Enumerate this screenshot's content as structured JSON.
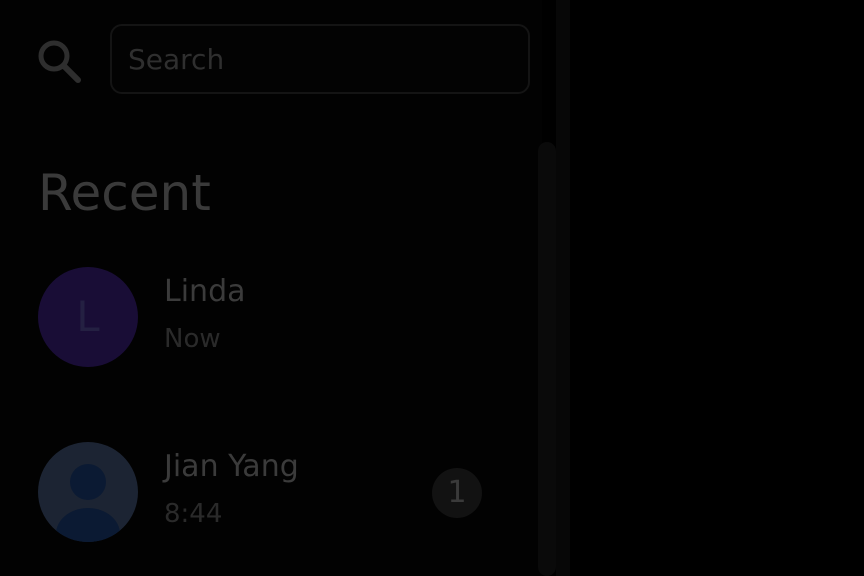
{
  "search": {
    "placeholder": "Search",
    "value": "",
    "icon": "search-icon"
  },
  "recent": {
    "title": "Recent",
    "contacts": [
      {
        "name": "Linda",
        "time": "Now",
        "avatar_letter": "L",
        "avatar_color": "#190d36",
        "avatar_type": "letter"
      },
      {
        "name": "Jian Yang",
        "time": "8:44",
        "unread": "1",
        "avatar_type": "person-icon",
        "avatar_color": "#1c2433"
      }
    ]
  },
  "colors": {
    "background": "#000000",
    "sidebar": "#020202",
    "text_primary": "#3b3b3b",
    "text_secondary": "#2a2a2a"
  }
}
